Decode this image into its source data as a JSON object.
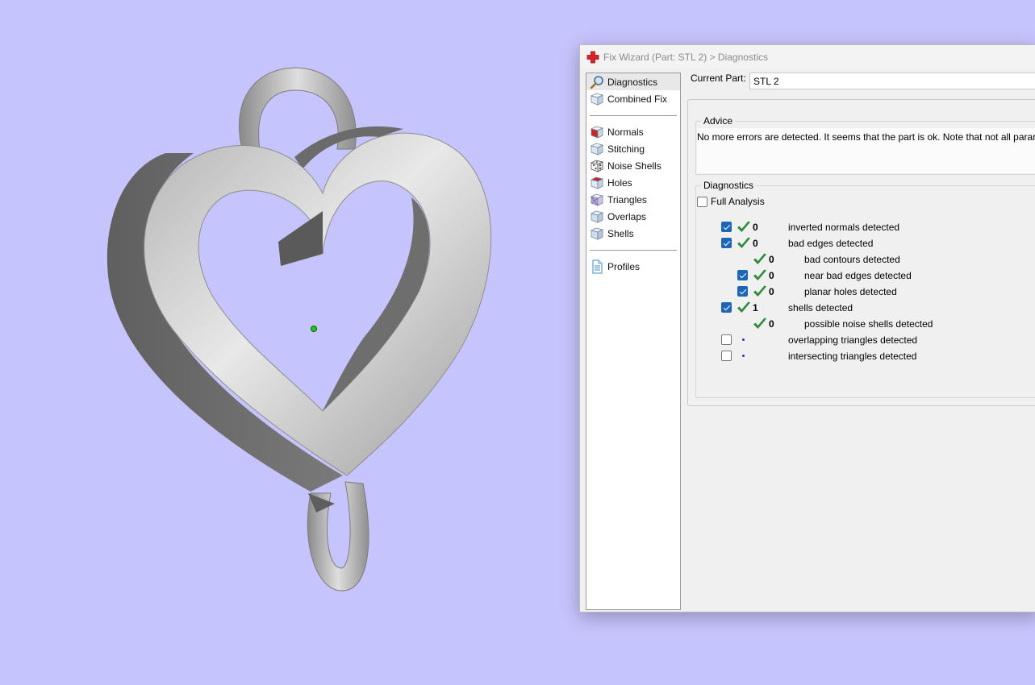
{
  "dialog": {
    "title": "Fix Wizard (Part: STL 2) > Diagnostics"
  },
  "nav": {
    "groups": [
      [
        {
          "label": "Diagnostics",
          "icon": "magnifier-icon",
          "selected": true
        },
        {
          "label": "Combined Fix",
          "icon": "cube-icon"
        }
      ],
      [
        {
          "label": "Normals",
          "icon": "normals-cube-icon"
        },
        {
          "label": "Stitching",
          "icon": "stitching-cube-icon"
        },
        {
          "label": "Noise Shells",
          "icon": "noise-shells-icon"
        },
        {
          "label": "Holes",
          "icon": "holes-cube-icon"
        },
        {
          "label": "Triangles",
          "icon": "triangles-cube-icon"
        },
        {
          "label": "Overlaps",
          "icon": "overlaps-cube-icon"
        },
        {
          "label": "Shells",
          "icon": "shells-cube-icon"
        }
      ],
      [
        {
          "label": "Profiles",
          "icon": "profiles-document-icon"
        }
      ]
    ]
  },
  "current_part": {
    "label": "Current Part:",
    "value": "STL 2"
  },
  "advice": {
    "legend": "Advice",
    "text": "No more errors are detected. It seems that the part is ok. Note that not all parameters"
  },
  "diagnostics": {
    "legend": "Diagnostics",
    "full_analysis_label": "Full Analysis",
    "full_analysis_checked": false,
    "rows": [
      {
        "indent": 0,
        "has_checkbox": true,
        "checked": true,
        "status": "ok",
        "count": "0",
        "label": "inverted normals detected"
      },
      {
        "indent": 0,
        "has_checkbox": true,
        "checked": true,
        "status": "ok",
        "count": "0",
        "label": "bad edges detected"
      },
      {
        "indent": 1,
        "has_checkbox": false,
        "checked": false,
        "status": "ok",
        "count": "0",
        "label": "bad contours detected"
      },
      {
        "indent": 1,
        "has_checkbox": true,
        "checked": true,
        "status": "ok",
        "count": "0",
        "label": "near bad edges detected"
      },
      {
        "indent": 1,
        "has_checkbox": true,
        "checked": true,
        "status": "ok",
        "count": "0",
        "label": "planar holes detected"
      },
      {
        "indent": 0,
        "has_checkbox": true,
        "checked": true,
        "status": "ok",
        "count": "1",
        "label": "shells detected"
      },
      {
        "indent": 1,
        "has_checkbox": false,
        "checked": false,
        "status": "ok",
        "count": "0",
        "label": "possible noise shells detected"
      },
      {
        "indent": 0,
        "has_checkbox": true,
        "checked": false,
        "status": "pending",
        "count": "",
        "label": "overlapping triangles detected"
      },
      {
        "indent": 0,
        "has_checkbox": true,
        "checked": false,
        "status": "pending",
        "count": "",
        "label": "intersecting triangles detected"
      }
    ]
  },
  "colors": {
    "viewport_background": "#c6c4fc",
    "check_green": "#2e8b3a",
    "checkbox_blue": "#1c66b5",
    "model_gray": "#9a9a9a",
    "pivot_green": "#22c822"
  }
}
